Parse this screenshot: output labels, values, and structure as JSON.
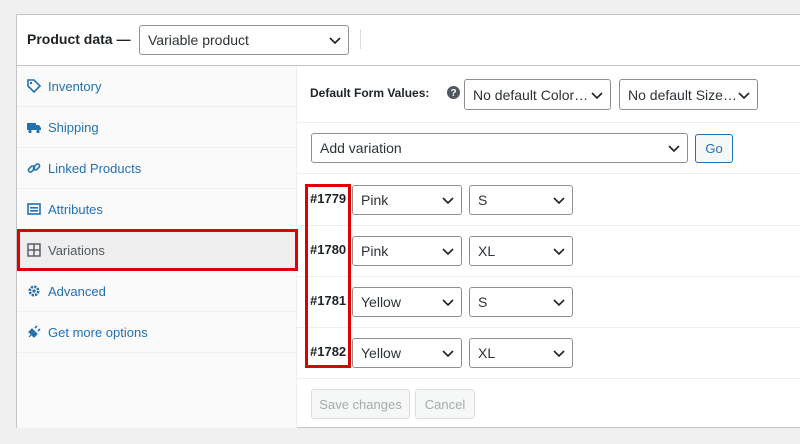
{
  "header": {
    "label": "Product data —",
    "product_type": "Variable product"
  },
  "sidebar": {
    "tabs": [
      {
        "label": "Inventory",
        "icon": "tag-icon"
      },
      {
        "label": "Shipping",
        "icon": "truck-icon"
      },
      {
        "label": "Linked Products",
        "icon": "link-icon"
      },
      {
        "label": "Attributes",
        "icon": "list-icon"
      },
      {
        "label": "Variations",
        "icon": "grid-icon",
        "active": true
      },
      {
        "label": "Advanced",
        "icon": "gear-icon"
      },
      {
        "label": "Get more options",
        "icon": "plugin-icon"
      }
    ]
  },
  "default_form": {
    "label": "Default Form Values:",
    "color_select": "No default Color…",
    "size_select": "No default Size…"
  },
  "add_variation": {
    "select": "Add variation",
    "go_label": "Go"
  },
  "variations": [
    {
      "id": "#1779",
      "color": "Pink",
      "size": "S"
    },
    {
      "id": "#1780",
      "color": "Pink",
      "size": "XL"
    },
    {
      "id": "#1781",
      "color": "Yellow",
      "size": "S"
    },
    {
      "id": "#1782",
      "color": "Yellow",
      "size": "XL"
    }
  ],
  "actions": {
    "save_label": "Save changes",
    "cancel_label": "Cancel"
  },
  "colors": {
    "link": "#2271b1",
    "highlight": "#e00000"
  }
}
